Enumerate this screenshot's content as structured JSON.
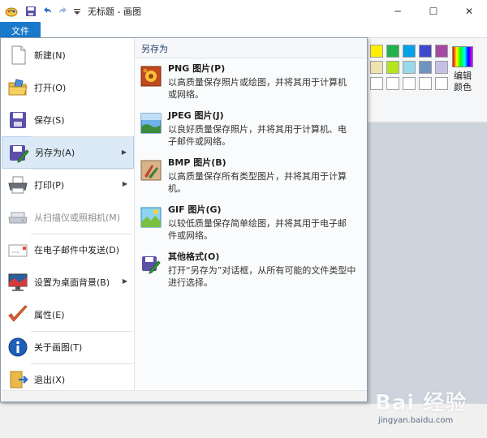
{
  "window": {
    "title": "无标题 - 画图",
    "minimize": "─",
    "maximize": "☐",
    "close": "✕"
  },
  "ribbon": {
    "file_tab": "文件",
    "edit_colors": "编辑颜色",
    "palette_row1": [
      "#ffee00",
      "#22b14c",
      "#00a2e8",
      "#3f48cc",
      "#a349a4"
    ],
    "palette_row2": [
      "#efe4b0",
      "#b5e61d",
      "#99d9ea",
      "#7092be",
      "#c8bfe7"
    ],
    "palette_row3": [
      "#ffffff",
      "#ffffff",
      "#ffffff",
      "#ffffff",
      "#ffffff"
    ]
  },
  "file_menu": {
    "items": [
      {
        "label": "新建(N)",
        "icon": "new-document-icon",
        "has_submenu": false,
        "disabled": false
      },
      {
        "label": "打开(O)",
        "icon": "open-folder-icon",
        "has_submenu": false,
        "disabled": false
      },
      {
        "label": "保存(S)",
        "icon": "save-disk-icon",
        "has_submenu": false,
        "disabled": false
      },
      {
        "label": "另存为(A)",
        "icon": "save-as-icon",
        "has_submenu": true,
        "disabled": false,
        "active": true
      },
      {
        "label": "打印(P)",
        "icon": "printer-icon",
        "has_submenu": true,
        "disabled": false
      },
      {
        "label": "从扫描仪或照相机(M)",
        "icon": "scanner-icon",
        "has_submenu": false,
        "disabled": true
      },
      {
        "label": "在电子邮件中发送(D)",
        "icon": "email-icon",
        "has_submenu": false,
        "disabled": false
      },
      {
        "label": "设置为桌面背景(B)",
        "icon": "desktop-background-icon",
        "has_submenu": true,
        "disabled": false
      },
      {
        "label": "属性(E)",
        "icon": "checkmark-icon",
        "has_submenu": false,
        "disabled": false
      },
      {
        "label": "关于画图(T)",
        "icon": "info-icon",
        "has_submenu": false,
        "disabled": false
      },
      {
        "label": "退出(X)",
        "icon": "exit-icon",
        "has_submenu": false,
        "disabled": false
      }
    ]
  },
  "save_as_submenu": {
    "header": "另存为",
    "options": [
      {
        "title": "PNG 图片(P)",
        "desc_line1": "以高质量保存照片或绘图，并将其用于计算机",
        "desc_line2": "或网络。",
        "icon": "png-image-icon"
      },
      {
        "title": "JPEG 图片(J)",
        "desc_line1": "以良好质量保存照片，并将其用于计算机、电",
        "desc_line2": "子邮件或网络。",
        "icon": "jpeg-image-icon"
      },
      {
        "title": "BMP 图片(B)",
        "desc_line1": "以高质量保存所有类型图片，并将其用于计算",
        "desc_line2": "机。",
        "icon": "bmp-image-icon"
      },
      {
        "title": "GIF 图片(G)",
        "desc_line1": "以较低质量保存简单绘图，并将其用于电子邮",
        "desc_line2": "件或网络。",
        "icon": "gif-image-icon"
      },
      {
        "title": "其他格式(O)",
        "desc_line1": "打开“另存为”对话框，从所有可能的文件类型中",
        "desc_line2": "进行选择。",
        "icon": "other-formats-icon"
      }
    ]
  },
  "watermark": {
    "logo": "Bai 经验",
    "url": "jingyan.baidu.com"
  }
}
